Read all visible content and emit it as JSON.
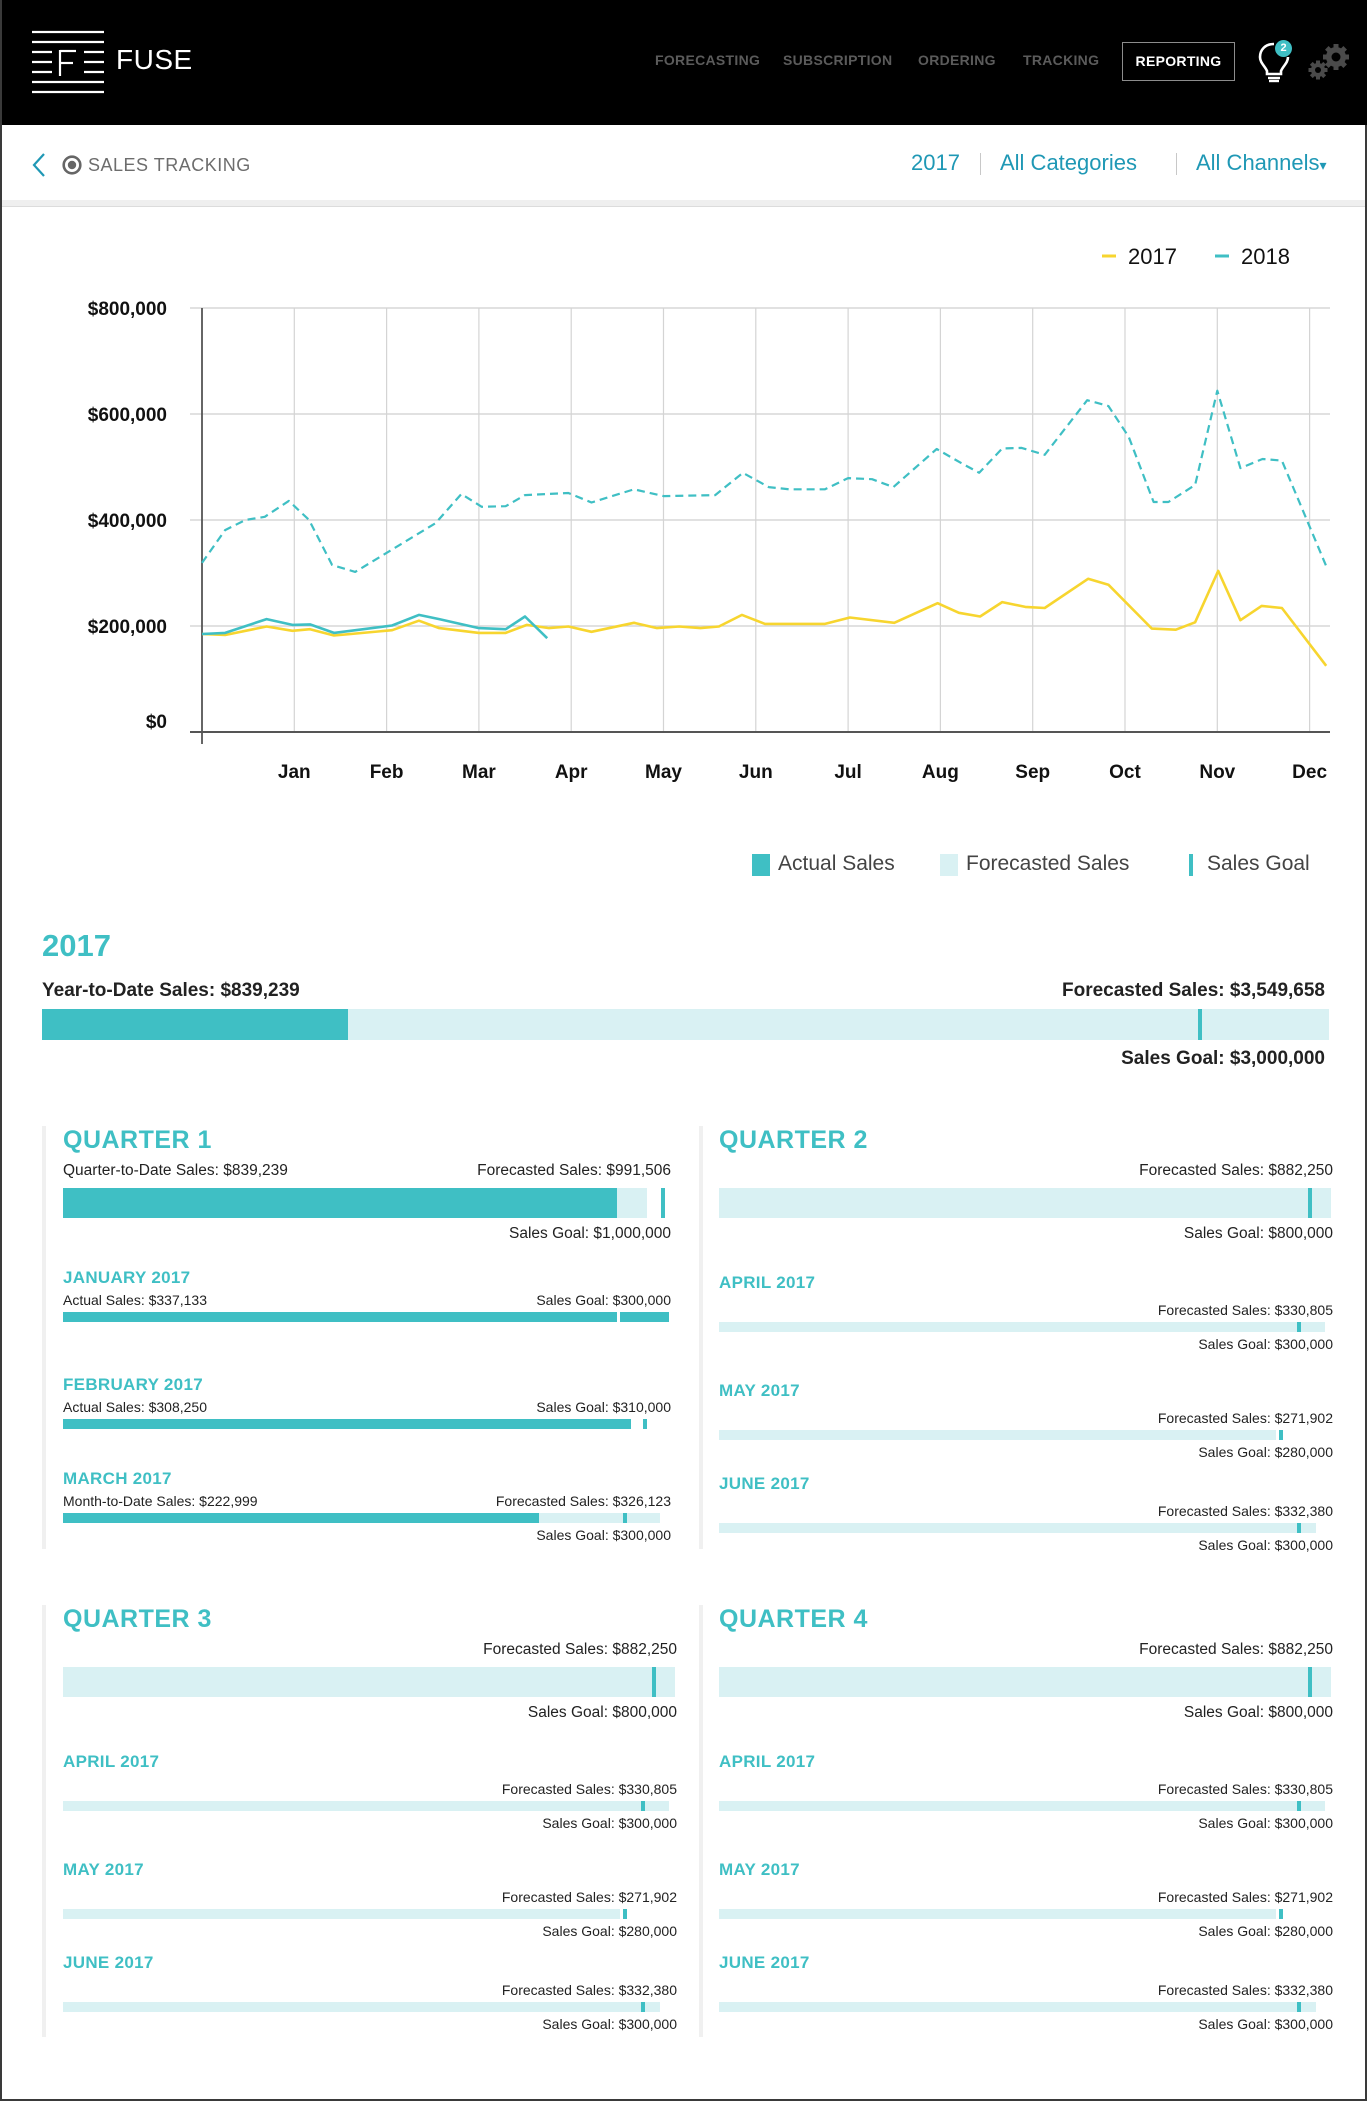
{
  "app": {
    "brand": "FUSE",
    "nav": [
      "FORECASTING",
      "SUBSCRIPTION",
      "ORDERING",
      "TRACKING"
    ],
    "nav_active": "REPORTING",
    "notification_count": "2",
    "icons": {
      "logo": "fuse-logo-icon",
      "bulb": "lightbulb-icon",
      "settings": "gears-icon",
      "back": "chevron-left-icon",
      "target": "target-icon"
    }
  },
  "subheader": {
    "title": "SALES TRACKING",
    "filters": {
      "year": "2017",
      "category": "All Categories",
      "channel": "All Channels"
    },
    "channel_caret": "▾"
  },
  "colors": {
    "accent": "#3fbfc4",
    "forecast": "#d9f1f3",
    "line2017": "#f7d52f",
    "line2018": "#3fbfc4",
    "link": "#1f98b5"
  },
  "chart_data": {
    "type": "line",
    "title": "",
    "xlabel": "",
    "ylabel": "",
    "x_ticks": [
      "Jan",
      "Feb",
      "Mar",
      "Apr",
      "May",
      "Jun",
      "Jul",
      "Aug",
      "Sep",
      "Oct",
      "Nov",
      "Dec"
    ],
    "y_ticks": [
      "$0",
      "$200,000",
      "$400,000",
      "$600,000",
      "$800,000"
    ],
    "y_tick_values": [
      0,
      200000,
      400000,
      600000,
      800000
    ],
    "ylim": [
      0,
      800000
    ],
    "xlim_months": [
      0,
      12.2
    ],
    "grid": true,
    "legend": {
      "position": "top-right",
      "entries": [
        "2017",
        "2018"
      ]
    },
    "series": [
      {
        "name": "2017",
        "style": "solid",
        "color": "#f7d52f",
        "x": [
          0,
          0.25,
          0.7,
          0.98,
          1.17,
          1.43,
          2.06,
          2.35,
          2.57,
          3.0,
          3.29,
          3.52,
          3.76,
          3.97,
          4.22,
          4.68,
          4.93,
          5.17,
          5.4,
          5.6,
          5.85,
          6.1,
          6.75,
          7.02,
          7.5,
          7.97,
          8.2,
          8.43,
          8.67,
          8.92,
          9.13,
          9.6,
          9.82,
          10.29,
          10.55,
          10.76,
          11.01,
          11.25,
          11.48,
          11.7,
          12.18
        ],
        "y": [
          185000,
          183000,
          199000,
          191000,
          194000,
          182000,
          192000,
          210000,
          196000,
          187000,
          187000,
          202000,
          196000,
          199000,
          189000,
          206000,
          196000,
          199000,
          196000,
          199000,
          221000,
          204000,
          204000,
          216000,
          206000,
          243000,
          225000,
          218000,
          245000,
          236000,
          234000,
          289000,
          278000,
          195000,
          193000,
          207000,
          304000,
          211000,
          238000,
          234000,
          125000
        ]
      },
      {
        "name": "2018 (forecast)",
        "style": "dashed",
        "color": "#3fbfc4",
        "x": [
          0,
          0.25,
          0.47,
          0.68,
          0.94,
          1.16,
          1.41,
          1.66,
          2.53,
          2.81,
          3.03,
          3.29,
          3.5,
          3.97,
          4.22,
          4.68,
          5.0,
          5.56,
          5.86,
          6.14,
          6.36,
          6.75,
          7.0,
          7.26,
          7.49,
          7.96,
          8.23,
          8.42,
          8.67,
          8.88,
          9.13,
          9.59,
          9.82,
          10.04,
          10.31,
          10.47,
          10.76,
          11.0,
          11.25,
          11.49,
          11.7,
          12.19
        ],
        "y": [
          319000,
          381000,
          400000,
          406000,
          436000,
          400000,
          315000,
          302000,
          394000,
          449000,
          425000,
          426000,
          447000,
          451000,
          433000,
          458000,
          445000,
          447000,
          489000,
          462000,
          458000,
          458000,
          479000,
          477000,
          462000,
          534000,
          507000,
          489000,
          535000,
          536000,
          523000,
          626000,
          615000,
          557000,
          434000,
          434000,
          466000,
          644000,
          498000,
          515000,
          512000,
          309000
        ]
      },
      {
        "name": "2018 (actual)",
        "style": "solid",
        "color": "#3fbfc4",
        "x": [
          0,
          0.25,
          0.7,
          0.98,
          1.17,
          1.43,
          2.06,
          2.35,
          2.57,
          3.0,
          3.29,
          3.5,
          3.74
        ],
        "y": [
          185000,
          187000,
          213000,
          202000,
          203000,
          187000,
          201000,
          221000,
          213000,
          196000,
          194000,
          218000,
          177000
        ]
      }
    ]
  },
  "bar_legend": [
    "Actual Sales",
    "Forecasted Sales",
    "Sales Goal"
  ],
  "year": {
    "title": "2017",
    "ytd_label": "Year-to-Date Sales: $839,239",
    "forecast_label": "Forecasted Sales: $3,549,658",
    "goal_label": "Sales Goal: $3,000,000",
    "actual_pct": 0.238,
    "forecast_pct": 1.0,
    "goal_pct": 0.9
  },
  "quarters": [
    {
      "title": "QUARTER 1",
      "left_label": "Quarter-to-Date Sales: $839,239",
      "forecast_label": "Forecasted Sales: $991,506",
      "goal_label": "Sales Goal: $1,000,000",
      "actual_pct": 0.915,
      "forecast_pct": 0.963,
      "goal_pct": 0.99,
      "months": [
        {
          "title": "JANUARY 2017",
          "left_label": "Actual Sales: $337,133",
          "right_label": "Sales Goal: $300,000",
          "actual_pct": 1.0,
          "forecast_pct": 1.0,
          "goal_pct": 0.918,
          "goal_style": "gap"
        },
        {
          "title": "FEBRUARY 2017",
          "left_label": "Actual Sales: $308,250",
          "right_label": "Sales Goal: $310,000",
          "actual_pct": 0.938,
          "forecast_pct": 0.938,
          "goal_pct": 0.96
        },
        {
          "title": "MARCH 2017",
          "left_label": "Month-to-Date Sales: $222,999",
          "right_label": "Forecasted Sales: $326,123",
          "below_label": "Sales Goal: $300,000",
          "actual_pct": 0.786,
          "forecast_pct": 0.985,
          "goal_pct": 0.928
        }
      ]
    },
    {
      "title": "QUARTER 2",
      "forecast_label": "Forecasted Sales: $882,250",
      "goal_label": "Sales Goal: $800,000",
      "actual_pct": 0,
      "forecast_pct": 1.0,
      "goal_pct": 0.965,
      "months": [
        {
          "title": "APRIL 2017",
          "right_label": "Forecasted Sales: $330,805",
          "below_label": "Sales Goal: $300,000",
          "actual_pct": 0,
          "forecast_pct": 0.99,
          "goal_pct": 0.947
        },
        {
          "title": "MAY 2017",
          "right_label": "Forecasted Sales: $271,902",
          "below_label": "Sales Goal: $280,000",
          "actual_pct": 0,
          "forecast_pct": 0.91,
          "goal_pct": 0.918
        },
        {
          "title": "JUNE 2017",
          "right_label": "Forecasted Sales: $332,380",
          "below_label": "Sales Goal: $300,000",
          "actual_pct": 0,
          "forecast_pct": 0.975,
          "goal_pct": 0.947
        }
      ]
    },
    {
      "title": "QUARTER 3",
      "forecast_label": "Forecasted Sales: $882,250",
      "goal_label": "Sales Goal: $800,000",
      "actual_pct": 0,
      "forecast_pct": 1.0,
      "goal_pct": 0.965,
      "months": [
        {
          "title": "APRIL 2017",
          "right_label": "Forecasted Sales: $330,805",
          "below_label": "Sales Goal: $300,000",
          "actual_pct": 0,
          "forecast_pct": 0.99,
          "goal_pct": 0.947
        },
        {
          "title": "MAY 2017",
          "right_label": "Forecasted Sales: $271,902",
          "below_label": "Sales Goal: $280,000",
          "actual_pct": 0,
          "forecast_pct": 0.91,
          "goal_pct": 0.918
        },
        {
          "title": "JUNE 2017",
          "right_label": "Forecasted Sales: $332,380",
          "below_label": "Sales Goal: $300,000",
          "actual_pct": 0,
          "forecast_pct": 0.975,
          "goal_pct": 0.947
        }
      ]
    },
    {
      "title": "QUARTER 4",
      "forecast_label": "Forecasted Sales: $882,250",
      "goal_label": "Sales Goal: $800,000",
      "actual_pct": 0,
      "forecast_pct": 1.0,
      "goal_pct": 0.965,
      "months": [
        {
          "title": "APRIL 2017",
          "right_label": "Forecasted Sales: $330,805",
          "below_label": "Sales Goal: $300,000",
          "actual_pct": 0,
          "forecast_pct": 0.99,
          "goal_pct": 0.947
        },
        {
          "title": "MAY 2017",
          "right_label": "Forecasted Sales: $271,902",
          "below_label": "Sales Goal: $280,000",
          "actual_pct": 0,
          "forecast_pct": 0.91,
          "goal_pct": 0.918
        },
        {
          "title": "JUNE 2017",
          "right_label": "Forecasted Sales: $332,380",
          "below_label": "Sales Goal: $300,000",
          "actual_pct": 0,
          "forecast_pct": 0.975,
          "goal_pct": 0.947
        }
      ]
    }
  ]
}
